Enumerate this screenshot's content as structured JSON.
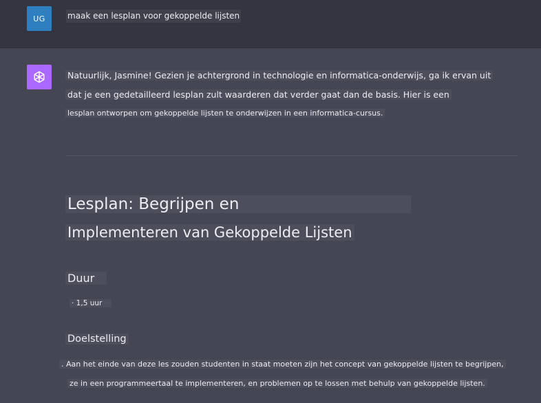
{
  "user_message": {
    "avatar": "UG",
    "text": "maak een lesplan voor gekoppelde lijsten"
  },
  "assistant_message": {
    "avatar_icon": "openai-logo-icon",
    "intro_lines": [
      "Natuurlijk, Jasmine! Gezien je achtergrond in technologie en informatica-onderwijs, ga ik ervan uit",
      "dat je een gedetailleerd lesplan zult waarderen dat verder gaat dan de basis. Hier is een",
      "lesplan ontworpen om gekoppelde lijsten te onderwijzen in een informatica-cursus."
    ],
    "title_lines": [
      "Lesplan: Begrijpen en",
      "Implementeren van Gekoppelde Lijsten"
    ],
    "duration_heading": "Duur",
    "duration_item": "· 1,5 uur",
    "objective_heading": "Doelstelling",
    "objective_lines": [
      ". Aan het einde van deze les zouden studenten in staat moeten zijn het concept van gekoppelde lijsten te begrijpen,",
      "ze in een programmeertaal te implementeren, en problemen op te lossen met behulp van gekoppelde lijsten."
    ]
  },
  "colors": {
    "user_row_bg": "#343541",
    "assistant_row_bg": "#444654",
    "user_avatar_bg": "#2d7fbf",
    "assistant_avatar_bg": "#ab68ff"
  }
}
